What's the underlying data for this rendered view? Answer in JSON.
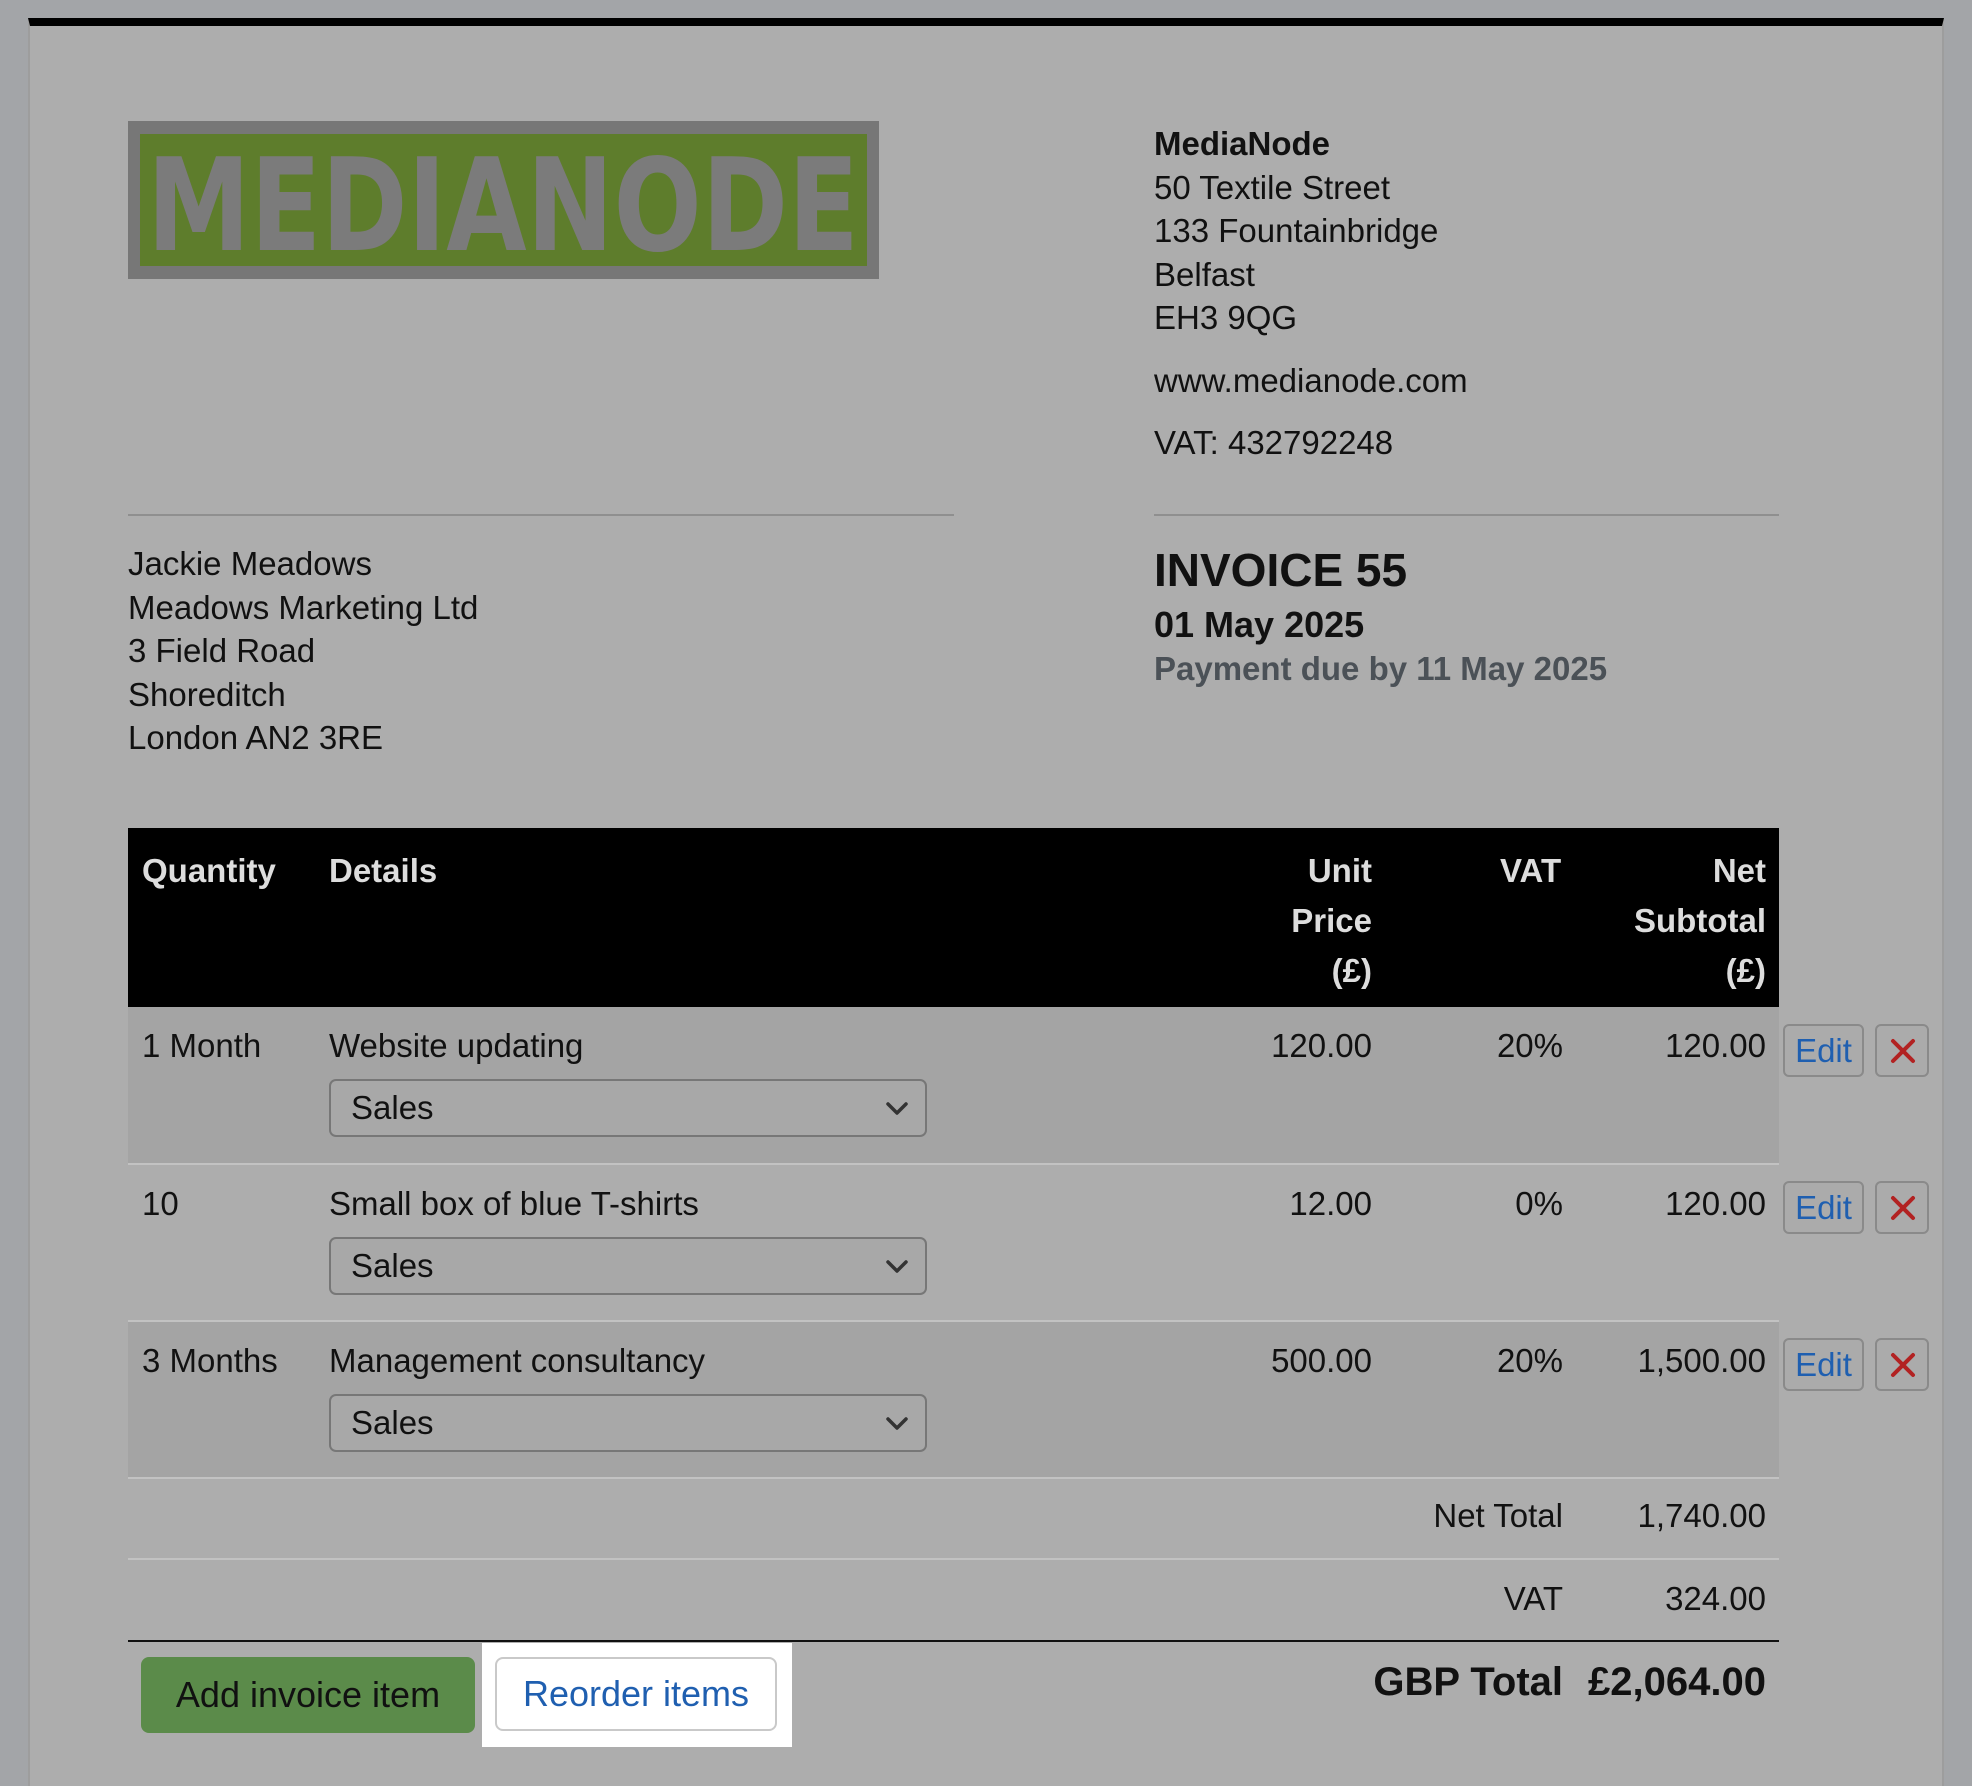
{
  "logo": {
    "text": "MEDIANODE"
  },
  "vendor": {
    "name": "MediaNode",
    "address": [
      "50 Textile Street",
      "133 Fountainbridge",
      "Belfast",
      "EH3 9QG"
    ],
    "website": "www.medianode.com",
    "vat": "VAT: 432792248"
  },
  "client": {
    "lines": [
      "Jackie Meadows",
      "Meadows Marketing Ltd",
      "3 Field Road",
      "Shoreditch",
      "London AN2 3RE"
    ]
  },
  "invoice": {
    "title": "INVOICE 55",
    "date": "01 May 2025",
    "due": "Payment due by 11 May 2025"
  },
  "table": {
    "headers": {
      "quantity": "Quantity",
      "details": "Details",
      "unit_price": [
        "Unit",
        "Price",
        "(£)"
      ],
      "vat": "VAT",
      "net_subtotal": [
        "Net",
        "Subtotal",
        "(£)"
      ]
    },
    "rows": [
      {
        "quantity": "1 Month",
        "details": "Website updating",
        "category": "Sales",
        "unit_price": "120.00",
        "vat": "20%",
        "subtotal": "120.00"
      },
      {
        "quantity": "10",
        "details": "Small box of blue T-shirts",
        "category": "Sales",
        "unit_price": "12.00",
        "vat": "0%",
        "subtotal": "120.00"
      },
      {
        "quantity": "3 Months",
        "details": "Management consultancy",
        "category": "Sales",
        "unit_price": "500.00",
        "vat": "20%",
        "subtotal": "1,500.00"
      }
    ],
    "edit_label": "Edit"
  },
  "totals": {
    "net_label": "Net Total",
    "net_value": "1,740.00",
    "vat_label": "VAT",
    "vat_value": "324.00",
    "grand_label": "GBP Total",
    "grand_value": "£2,064.00"
  },
  "actions": {
    "add_item": "Add invoice item",
    "reorder": "Reorder items"
  },
  "colors": {
    "accent_green": "#5b8b4a",
    "link_blue": "#1f5fb0",
    "delete_red": "#b22222"
  }
}
